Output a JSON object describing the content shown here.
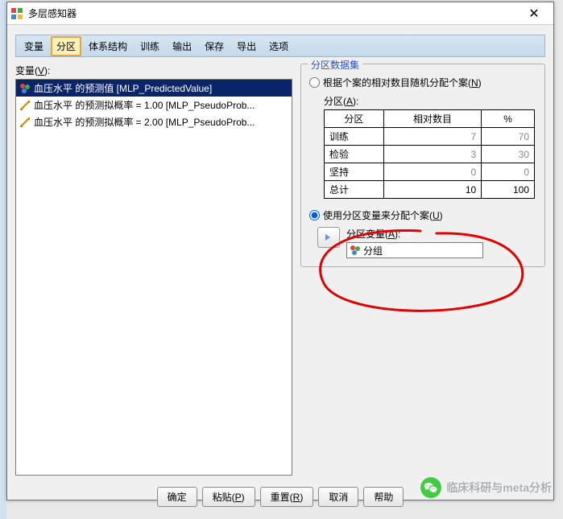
{
  "window": {
    "title": "多层感知器",
    "close_glyph": "✕"
  },
  "tabs": [
    {
      "label": "变量"
    },
    {
      "label": "分区",
      "active": true
    },
    {
      "label": "体系结构"
    },
    {
      "label": "训练"
    },
    {
      "label": "输出"
    },
    {
      "label": "保存"
    },
    {
      "label": "导出"
    },
    {
      "label": "选项"
    }
  ],
  "left": {
    "label_prefix": "变量(",
    "label_mnemonic": "V",
    "label_suffix": "):",
    "items": [
      {
        "type": "nominal",
        "text": "血压水平 的预测值 [MLP_PredictedValue]",
        "selected": true
      },
      {
        "type": "scale",
        "text": "血压水平 的预测拟概率 = 1.00 [MLP_PseudoProb..."
      },
      {
        "type": "scale",
        "text": "血压水平 的预测拟概率 = 2.00 [MLP_PseudoProb..."
      }
    ]
  },
  "right": {
    "legend": "分区数据集",
    "radio1_prefix": "根据个案的相对数目随机分配个案(",
    "radio1_mnemonic": "N",
    "radio1_suffix": ")",
    "partition_label_prefix": "分区(",
    "partition_label_mnemonic": "A",
    "partition_label_suffix": "):",
    "table": {
      "headers": [
        "分区",
        "相对数目",
        "%"
      ],
      "rows": [
        {
          "name": "训练",
          "rel": "7",
          "pct": "70"
        },
        {
          "name": "检验",
          "rel": "3",
          "pct": "30"
        },
        {
          "name": "坚持",
          "rel": "0",
          "pct": "0"
        },
        {
          "name": "总计",
          "rel": "10",
          "pct": "100",
          "total": true
        }
      ]
    },
    "radio2_prefix": "使用分区变量来分配个案(",
    "radio2_mnemonic": "U",
    "radio2_suffix": ")",
    "var_label_prefix": "分区变量(",
    "var_label_mnemonic": "A",
    "var_label_suffix": "):",
    "var_value": "分组"
  },
  "buttons": {
    "ok": "确定",
    "paste_prefix": "粘贴(",
    "paste_mnemonic": "P",
    "paste_suffix": ")",
    "reset_prefix": "重置(",
    "reset_mnemonic": "R",
    "reset_suffix": ")",
    "cancel": "取消",
    "help": "帮助"
  },
  "watermark": {
    "text": "临床科研与meta分析"
  }
}
